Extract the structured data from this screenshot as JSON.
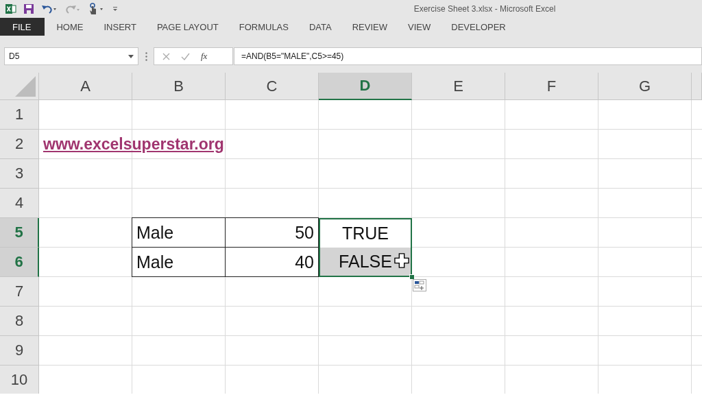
{
  "window": {
    "title": "Exercise Sheet 3.xlsx - Microsoft Excel"
  },
  "ribbon_tabs": [
    {
      "label": "FILE",
      "kind": "file",
      "selected": false
    },
    {
      "label": "HOME",
      "kind": "tab",
      "selected": false
    },
    {
      "label": "INSERT",
      "kind": "tab",
      "selected": false
    },
    {
      "label": "PAGE LAYOUT",
      "kind": "tab",
      "selected": false
    },
    {
      "label": "FORMULAS",
      "kind": "tab",
      "selected": false
    },
    {
      "label": "DATA",
      "kind": "tab",
      "selected": false
    },
    {
      "label": "REVIEW",
      "kind": "tab",
      "selected": false
    },
    {
      "label": "VIEW",
      "kind": "tab",
      "selected": false
    },
    {
      "label": "DEVELOPER",
      "kind": "tab",
      "selected": false
    }
  ],
  "formula_bar": {
    "name_box": "D5",
    "function_label": "fx",
    "formula": "=AND(B5=\"MALE\",C5>=45)"
  },
  "columns": [
    {
      "label": "A",
      "selected": false
    },
    {
      "label": "B",
      "selected": false
    },
    {
      "label": "C",
      "selected": false
    },
    {
      "label": "D",
      "selected": true
    },
    {
      "label": "E",
      "selected": false
    },
    {
      "label": "F",
      "selected": false
    },
    {
      "label": "G",
      "selected": false
    }
  ],
  "rows": [
    {
      "label": "1",
      "selected": false,
      "cells": []
    },
    {
      "label": "2",
      "selected": false,
      "cells": [
        {
          "kind": "link",
          "value": "www.excelsuperstar.org"
        }
      ]
    },
    {
      "label": "3",
      "selected": false,
      "cells": []
    },
    {
      "label": "4",
      "selected": false,
      "cells": []
    },
    {
      "label": "5",
      "selected": true,
      "cells": [
        null,
        {
          "kind": "text",
          "value": "Male",
          "bordered": true
        },
        {
          "kind": "number",
          "value": "50",
          "bordered": true
        },
        {
          "kind": "boolean",
          "value": "TRUE",
          "selected": true,
          "active": true
        }
      ]
    },
    {
      "label": "6",
      "selected": true,
      "cells": [
        null,
        {
          "kind": "text",
          "value": "Male",
          "bordered": true
        },
        {
          "kind": "number",
          "value": "40",
          "bordered": true
        },
        {
          "kind": "boolean",
          "value": "FALSE",
          "selected": true,
          "active": false
        }
      ]
    },
    {
      "label": "7",
      "selected": false,
      "cells": []
    },
    {
      "label": "8",
      "selected": false,
      "cells": []
    },
    {
      "label": "9",
      "selected": false,
      "cells": []
    },
    {
      "label": "10",
      "selected": false,
      "cells": []
    }
  ]
}
